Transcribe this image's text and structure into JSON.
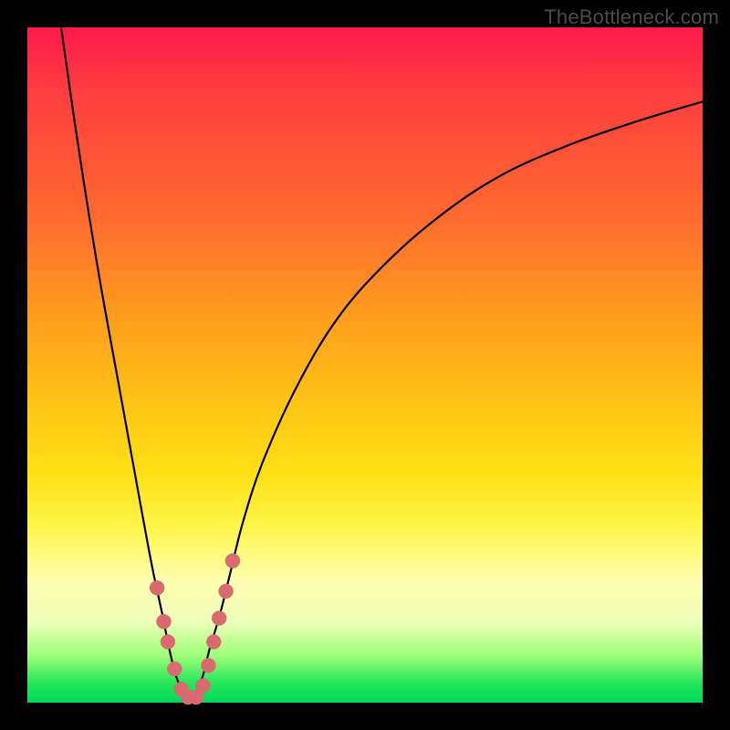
{
  "watermark": "TheBottleneck.com",
  "colors": {
    "frame": "#000000",
    "curve": "#000000",
    "marker": "#d96a6f",
    "gradient_top": "#ff1a4b",
    "gradient_bottom": "#00d85a"
  },
  "chart_data": {
    "type": "line",
    "title": "",
    "xlabel": "",
    "ylabel": "",
    "xlim": [
      0,
      100
    ],
    "ylim": [
      0,
      100
    ],
    "grid": false,
    "series": [
      {
        "name": "left-branch",
        "x": [
          5,
          7,
          9,
          11,
          13,
          15,
          17,
          18.5,
          20,
          21,
          22,
          23,
          24
        ],
        "y": [
          100,
          86,
          73,
          61,
          50,
          39,
          28,
          20,
          13,
          8,
          4,
          1.5,
          0
        ]
      },
      {
        "name": "right-branch",
        "x": [
          24,
          25,
          26,
          27,
          28.5,
          30,
          32,
          35,
          40,
          46,
          53,
          61,
          70,
          80,
          90,
          100
        ],
        "y": [
          0,
          1.5,
          4,
          8,
          13,
          19,
          27,
          36,
          47,
          57,
          65,
          72,
          78,
          82.5,
          86,
          89
        ]
      }
    ],
    "markers": {
      "name": "marker-dots",
      "x": [
        19.2,
        20.2,
        20.8,
        21.8,
        22.8,
        23.8,
        25.0,
        26.0,
        26.8,
        27.6,
        28.4,
        29.4,
        30.4
      ],
      "y": [
        17.0,
        12.0,
        9.0,
        5.0,
        2.0,
        0.8,
        0.8,
        2.5,
        5.5,
        9.0,
        12.5,
        16.5,
        21.0
      ],
      "r": 8
    },
    "annotations": []
  }
}
